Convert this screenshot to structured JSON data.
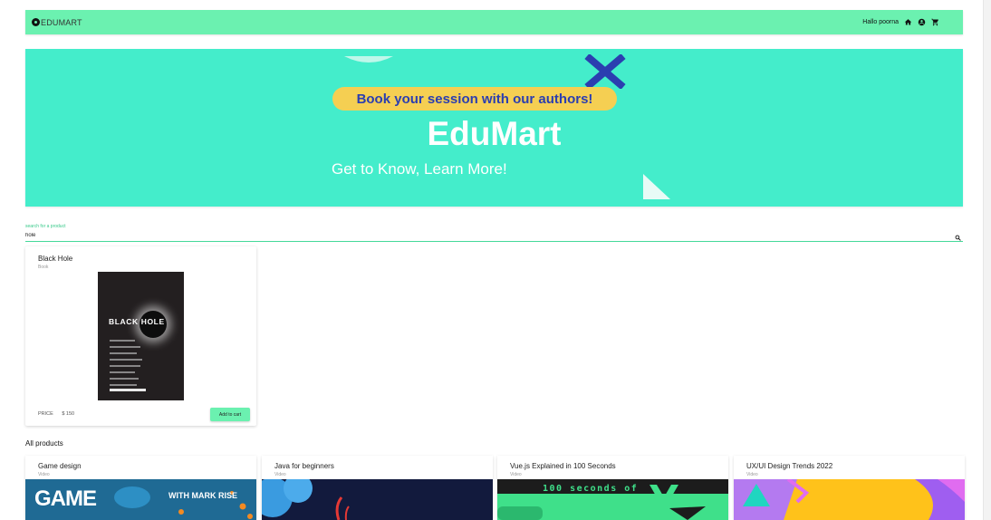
{
  "header": {
    "brand": "EDUMART",
    "greeting": "Hallo poorna"
  },
  "banner": {
    "pill_text": "Book your session with our authors!",
    "title": "EduMart",
    "subtitle": "Get to Know, Learn More!"
  },
  "search": {
    "label": "search for a product",
    "value": "hole"
  },
  "result": {
    "title": "Black Hole",
    "type": "Book",
    "cover_title": "BLACK HOLE",
    "price_label": "PRICE",
    "price": "$ 150",
    "add_label": "Add to cart"
  },
  "all_products": {
    "title": "All products",
    "items": [
      {
        "title": "Game design",
        "type": "Video",
        "thumb_text": "GAME",
        "thumb_text2": "WITH MARK RISE"
      },
      {
        "title": "Java for beginners",
        "type": "Video"
      },
      {
        "title": "Vue.js Explained in 100 Seconds",
        "type": "Video",
        "thumb_text": "100 seconds of"
      },
      {
        "title": "UX/UI Design Trends 2022",
        "type": "Video"
      }
    ]
  },
  "colors": {
    "topbar": "#6bf1b0",
    "banner": "#44edcb",
    "pill": "#f5cf52",
    "accent_blue": "#2b3eb0"
  }
}
